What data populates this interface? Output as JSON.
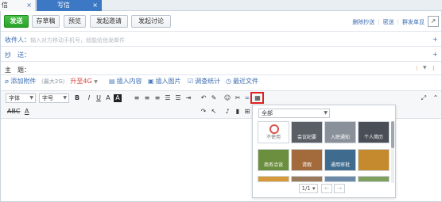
{
  "tabs": [
    {
      "label": "信",
      "close": "×"
    },
    {
      "label": "写信",
      "close": "×"
    }
  ],
  "toolbar": {
    "send": "发送",
    "draft": "存草稿",
    "preview": "预览",
    "invite": "发起邀请",
    "discuss": "发起讨论",
    "links": [
      "删除抄送",
      "密送",
      "群发单显"
    ]
  },
  "fields": {
    "to_label": "收件人：",
    "to_placeholder": "输入对方移动手机号，就能给他发邮件",
    "cc_label": "抄　送：",
    "subject_label": "主　题："
  },
  "attachments": {
    "add": "添加附件",
    "limit": "（最大2G）",
    "upgrade": "升至4G",
    "items": [
      "插入内容",
      "插入图片",
      "调查统计",
      "最近文件"
    ]
  },
  "editor": {
    "font_select": "字体",
    "size_select": "字号",
    "row2": [
      "ABC",
      "A"
    ]
  },
  "template_panel": {
    "category": "全部",
    "thumbs": [
      {
        "caption": "不使用",
        "color": "#ffffff"
      },
      {
        "caption": "会议纪要",
        "color": "#5a5f66"
      },
      {
        "caption": "入职通知",
        "color": "#8a9099"
      },
      {
        "caption": "个人简历",
        "color": "#4a4f57"
      },
      {
        "caption": "商务洽谈",
        "color": "#6b8f3f"
      },
      {
        "caption": "请假",
        "color": "#a36a3c"
      },
      {
        "caption": "通用审批",
        "color": "#3f6b8f"
      },
      {
        "caption": "",
        "color": "#c68a2e"
      },
      {
        "caption": "",
        "color": "#d79a3a"
      },
      {
        "caption": "",
        "color": "#9a7a5a"
      },
      {
        "caption": "",
        "color": "#6a8aa8"
      },
      {
        "caption": "",
        "color": "#7f9f5f"
      }
    ],
    "page": "1/1",
    "prev": "←",
    "next": "→"
  }
}
